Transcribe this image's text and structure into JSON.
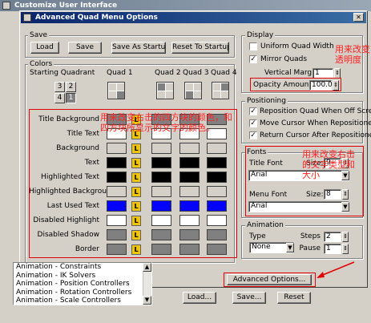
{
  "bg_window": {
    "title": "Customize User Interface"
  },
  "dialog": {
    "title": "Advanced Quad Menu Options"
  },
  "save_group": {
    "label": "Save",
    "load": "Load",
    "save": "Save",
    "save_as_startup": "Save As Startup",
    "reset_to_startup": "Reset To Startup"
  },
  "colors_group": {
    "label": "Colors",
    "starting_quadrant": "Starting Quadrant",
    "quad_headers": [
      "Quad 1",
      "Quad 2",
      "Quad 3",
      "Quad 4"
    ],
    "quadrant_numbers": [
      "3",
      "2",
      "4",
      "1"
    ],
    "row_labels": [
      "Title Background",
      "Title Text",
      "Background",
      "Text",
      "Highlighted Text",
      "Highlighted Background",
      "Last Used Text",
      "Disabled Highlight",
      "Disabled Shadow",
      "Border"
    ],
    "lock_label": "L"
  },
  "display_group": {
    "label": "Display",
    "uniform_quad_width": "Uniform Quad Width",
    "mirror_quads": "Mirror Quads",
    "vertical_margins": "Vertical Margins",
    "vertical_margins_value": "1",
    "opacity_amount": "Opacity Amount:",
    "opacity_value": "100.0"
  },
  "positioning_group": {
    "label": "Positioning",
    "reposition": "Reposition Quad When Off Screen",
    "move_cursor": "Move Cursor When Repositioned",
    "return_cursor": "Return Cursor After Repositioned"
  },
  "fonts_group": {
    "label": "Fonts",
    "title_font": "Title Font",
    "size": "Size:",
    "title_size": "9",
    "title_font_value": "Arial",
    "menu_font": "Menu Font",
    "menu_size": "8",
    "menu_font_value": "Arial"
  },
  "animation_group": {
    "label": "Animation",
    "type": "Type",
    "steps": "Steps",
    "steps_value": "2",
    "type_value": "None",
    "pause": "Pause",
    "pause_value": "1"
  },
  "advanced_options": "Advanced Options...",
  "bottom_list": [
    "Animation - Constraints",
    "Animation - IK Solvers",
    "Animation - Position Controllers",
    "Animation - Rotation Controllers",
    "Animation - Scale Controllers"
  ],
  "bottom_buttons": {
    "load": "Load...",
    "save": "Save...",
    "reset": "Reset"
  },
  "annotations": {
    "colors": "用来改变右击的四方块的颜色，和四方块所显示的文字的颜色。",
    "opacity": "用来改变透明度",
    "fonts": "用来改变右击的文字类型和大小"
  },
  "colors": {
    "title": "#0a246a",
    "accent_red": "#e00000",
    "lock_yellow": "#f0c400",
    "last_used_blue": "#0000ff"
  }
}
